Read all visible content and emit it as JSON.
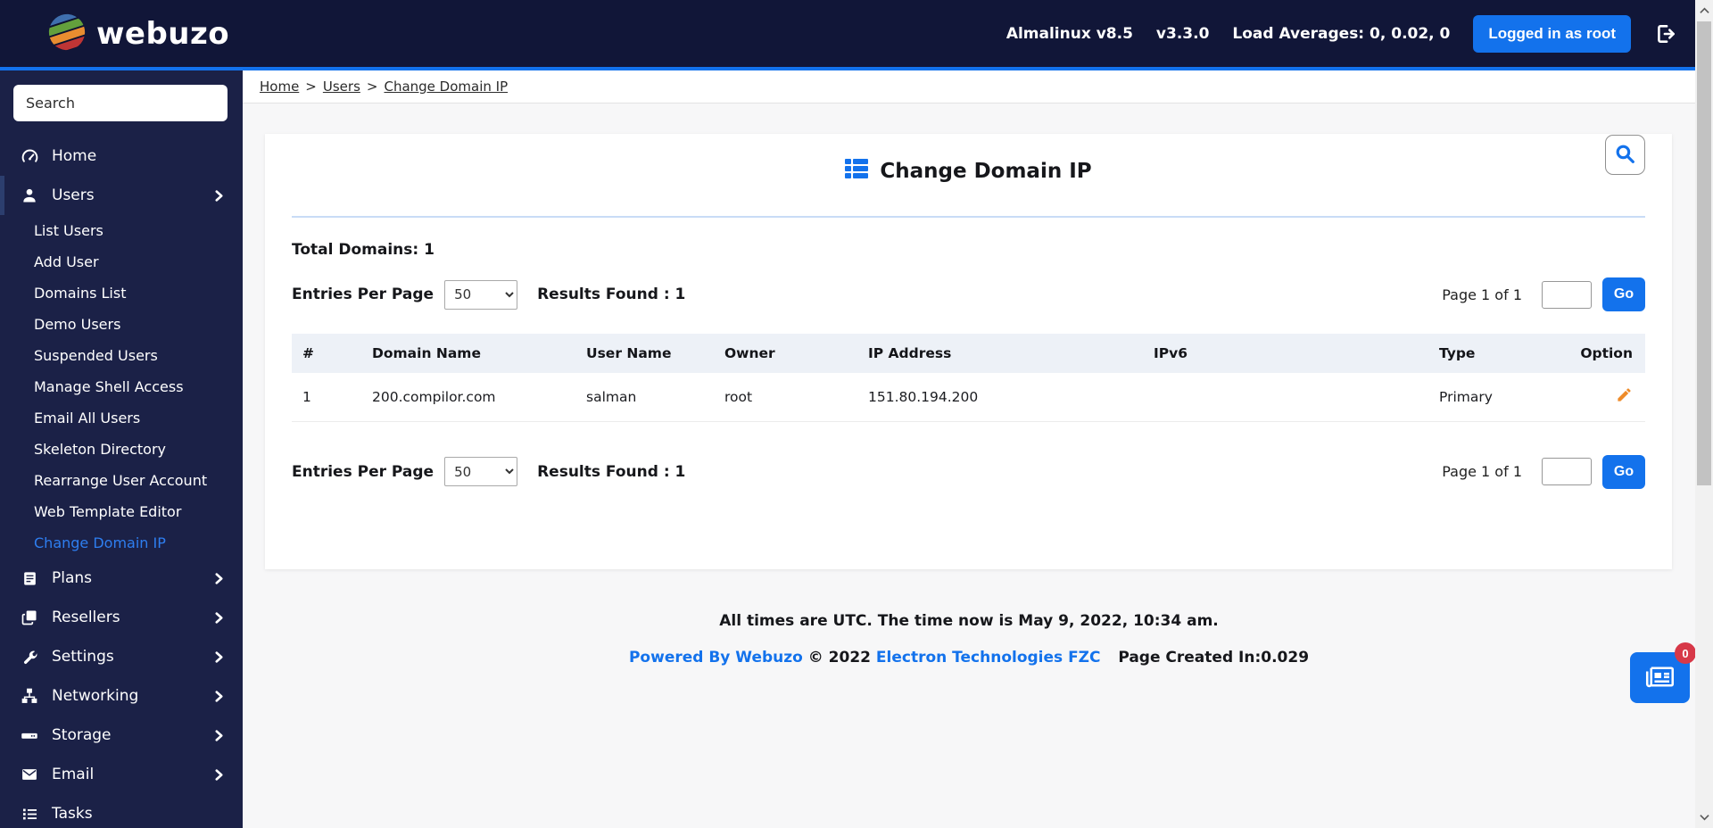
{
  "header": {
    "logo": "webuzo",
    "os": "Almalinux v8.5",
    "version": "v3.3.0",
    "load": "Load Averages: 0, 0.02, 0",
    "login_status": "Logged in as root"
  },
  "sidebar": {
    "search_placeholder": "Search",
    "items": [
      {
        "label": "Home",
        "icon": "gauge-icon"
      },
      {
        "label": "Users",
        "icon": "user-icon"
      },
      {
        "label": "Plans",
        "icon": "plans-icon"
      },
      {
        "label": "Resellers",
        "icon": "resellers-icon"
      },
      {
        "label": "Settings",
        "icon": "wrench-icon"
      },
      {
        "label": "Networking",
        "icon": "network-icon"
      },
      {
        "label": "Storage",
        "icon": "storage-icon"
      },
      {
        "label": "Email",
        "icon": "envelope-icon"
      },
      {
        "label": "Tasks",
        "icon": "tasks-icon"
      }
    ],
    "users_submenu": [
      "List Users",
      "Add User",
      "Domains List",
      "Demo Users",
      "Suspended Users",
      "Manage Shell Access",
      "Email All Users",
      "Skeleton Directory",
      "Rearrange User Account",
      "Web Template Editor",
      "Change Domain IP"
    ],
    "active_item": "Change Domain IP"
  },
  "breadcrumb": {
    "items": [
      "Home",
      "Users",
      "Change Domain IP"
    ],
    "separator": ">"
  },
  "page": {
    "title": "Change Domain IP",
    "total_domains": "Total Domains: 1",
    "entries_label": "Entries Per Page",
    "entries_value": "50",
    "results_label": "Results Found : 1",
    "page_indicator": "Page 1 of 1",
    "go_button": "Go",
    "goto_page_value": ""
  },
  "table": {
    "headers": [
      "#",
      "Domain Name",
      "User Name",
      "Owner",
      "IP Address",
      "IPv6",
      "Type",
      "Option"
    ],
    "rows": [
      {
        "num": "1",
        "domain": "200.compilor.com",
        "user": "salman",
        "owner": "root",
        "ip": "151.80.194.200",
        "ipv6": "",
        "type": "Primary"
      }
    ]
  },
  "footer": {
    "utc_line": "All times are UTC. The time now is May 9, 2022, 10:34 am.",
    "powered_by": "Powered By Webuzo",
    "copyright": "© 2022",
    "company": "Electron Technologies FZC",
    "created_in": "Page Created In:0.029"
  },
  "widget": {
    "badge_count": "0"
  },
  "colors": {
    "accent": "#1372ec",
    "header_bg": "#111638",
    "sidebar_bg": "#1b2147",
    "active_link": "#2e7ef0",
    "pencil_orange": "#ee8b29",
    "badge_red": "#d73848",
    "table_header_bg": "#edf1f7"
  }
}
